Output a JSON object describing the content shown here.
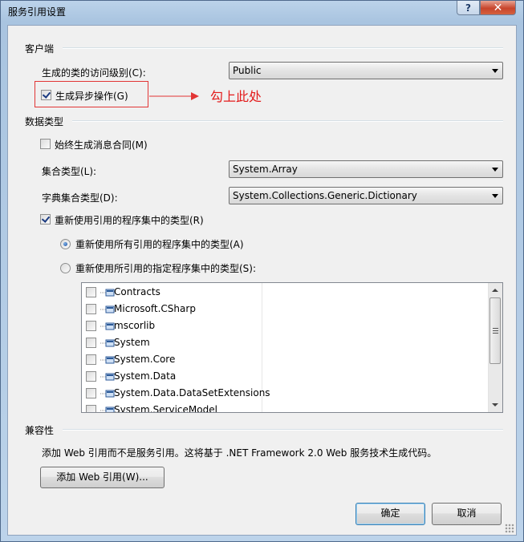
{
  "window": {
    "title": "服务引用设置",
    "help_label": "?",
    "close_label": "✕"
  },
  "client_group": {
    "label": "客户端",
    "access_level_label": "生成的类的访问级别(C):",
    "access_level_value": "Public",
    "async_label": "生成异步操作(G)",
    "async_checked": true
  },
  "annotation": {
    "text": "勾上此处",
    "color": "#e31b1b"
  },
  "data_type_group": {
    "label": "数据类型",
    "always_generate_label": "始终生成消息合同(M)",
    "always_generate_checked": false,
    "collection_type_label": "集合类型(L):",
    "collection_type_value": "System.Array",
    "dictionary_type_label": "字典集合类型(D):",
    "dictionary_type_value": "System.Collections.Generic.Dictionary",
    "reuse_types_label": "重新使用引用的程序集中的类型(R)",
    "reuse_types_checked": true,
    "reuse_all_label": "重新使用所有引用的程序集中的类型(A)",
    "reuse_specified_label": "重新使用所引用的指定程序集中的类型(S):",
    "selected_reuse_option": "all",
    "assemblies": [
      "Contracts",
      "Microsoft.CSharp",
      "mscorlib",
      "System",
      "System.Core",
      "System.Data",
      "System.Data.DataSetExtensions",
      "System.ServiceModel"
    ]
  },
  "compat_group": {
    "label": "兼容性",
    "description": "添加 Web 引用而不是服务引用。这将基于 .NET Framework 2.0 Web 服务技术生成代码。",
    "add_web_ref_button": "添加 Web 引用(W)..."
  },
  "footer": {
    "ok_label": "确定",
    "cancel_label": "取消"
  }
}
